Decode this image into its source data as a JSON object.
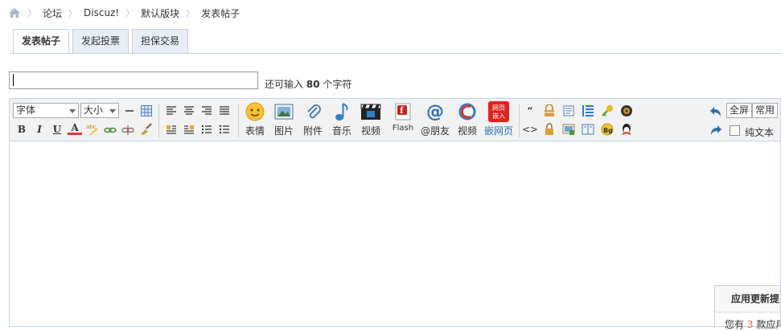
{
  "breadcrumb": [
    "论坛",
    "Discuz!",
    "默认版块",
    "发表帖子"
  ],
  "tabs": [
    "发表帖子",
    "发起投票",
    "担保交易"
  ],
  "subject": {
    "value": "",
    "remain_prefix": "还可输入",
    "remain_count": "80",
    "remain_suffix": "个字符"
  },
  "toolbar": {
    "font_select": "字体",
    "size_select": "大小",
    "format_buttons": [
      "B",
      "I",
      "U",
      "A"
    ],
    "big_buttons": [
      "表情",
      "图片",
      "附件",
      "音乐",
      "视频",
      "Flash",
      "@朋友",
      "视频",
      "嵌网页"
    ],
    "fullscreen_label": "全屏",
    "common_label": "常用",
    "plaintext_label": "纯文本",
    "embed_icon_text": "网页 嵌入"
  },
  "popup": {
    "title": "应用更新提",
    "body_prefix": "您有",
    "body_count": "3",
    "body_suffix": "款应用"
  },
  "colors": {
    "tab_border": "#c2d5e3",
    "toolbar_bg": "#f2f2f2",
    "accent_blue": "#336699",
    "count_red": "#f26c4f"
  }
}
